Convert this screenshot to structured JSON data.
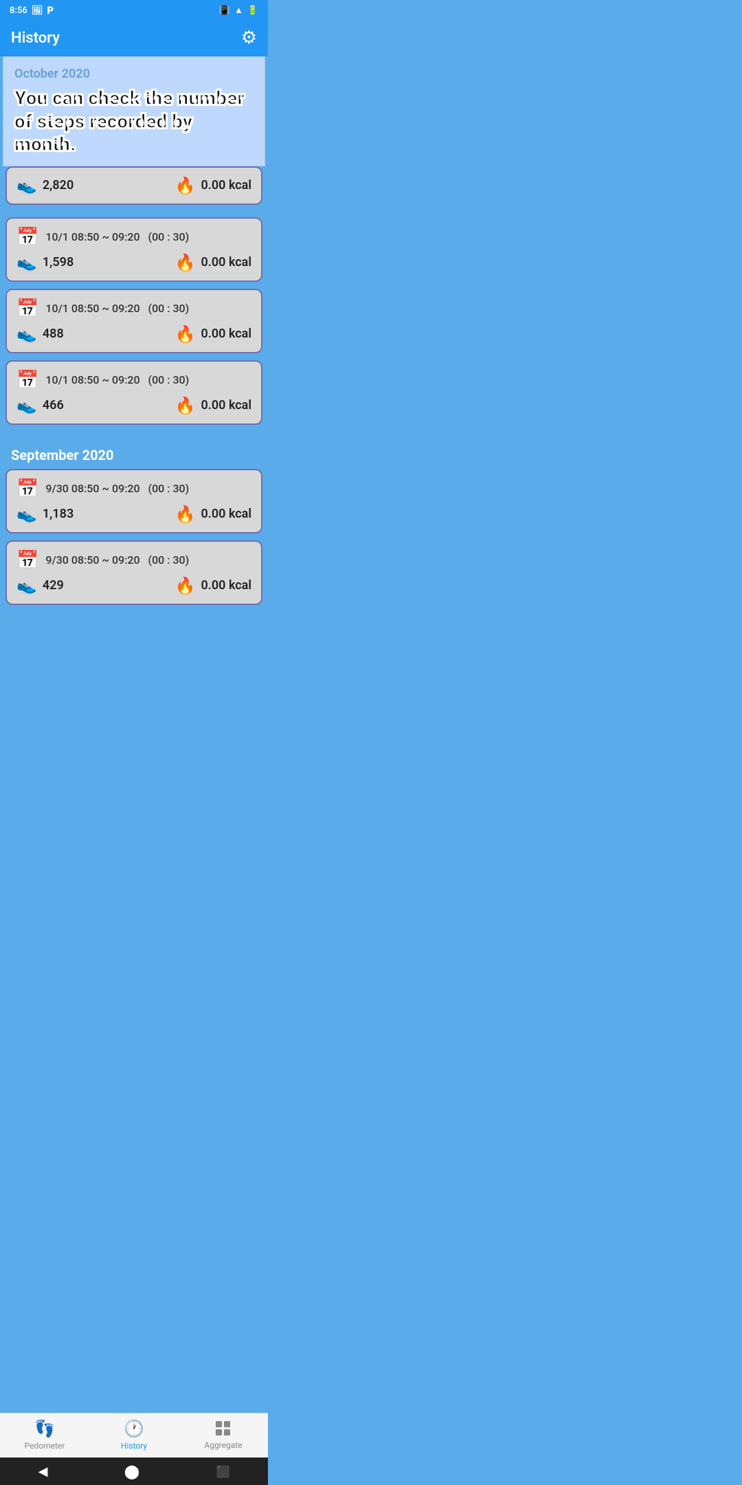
{
  "statusBar": {
    "time": "8:56",
    "batteryIcon": "🔋"
  },
  "appBar": {
    "title": "History",
    "settingsIcon": "⚙"
  },
  "tooltip": {
    "text": "You can check the number of steps recorded by month."
  },
  "octSection": {
    "monthLabel": "October 2020",
    "partialCard": {
      "steps": "2,820",
      "kcal": "0.00 kcal"
    },
    "cards": [
      {
        "date": "10/1",
        "timeRange": "08:50 ~ 09:20",
        "duration": "(00 : 30)",
        "steps": "1,598",
        "kcal": "0.00 kcal"
      },
      {
        "date": "10/1",
        "timeRange": "08:50 ~ 09:20",
        "duration": "(00 : 30)",
        "steps": "488",
        "kcal": "0.00 kcal"
      },
      {
        "date": "10/1",
        "timeRange": "08:50 ~ 09:20",
        "duration": "(00 : 30)",
        "steps": "466",
        "kcal": "0.00 kcal"
      }
    ]
  },
  "sepSection": {
    "monthLabel": "September 2020",
    "cards": [
      {
        "date": "9/30",
        "timeRange": "08:50 ~ 09:20",
        "duration": "(00 : 30)",
        "steps": "1,183",
        "kcal": "0.00 kcal"
      },
      {
        "date": "9/30",
        "timeRange": "08:50 ~ 09:20",
        "duration": "(00 : 30)",
        "steps": "429",
        "kcal": "0.00 kcal"
      }
    ]
  },
  "bottomNav": {
    "items": [
      {
        "id": "pedometer",
        "label": "Pedometer",
        "icon": "👣",
        "active": false
      },
      {
        "id": "history",
        "label": "History",
        "icon": "🕐",
        "active": true
      },
      {
        "id": "aggregate",
        "label": "Aggregate",
        "icon": "⊞",
        "active": false
      }
    ]
  }
}
